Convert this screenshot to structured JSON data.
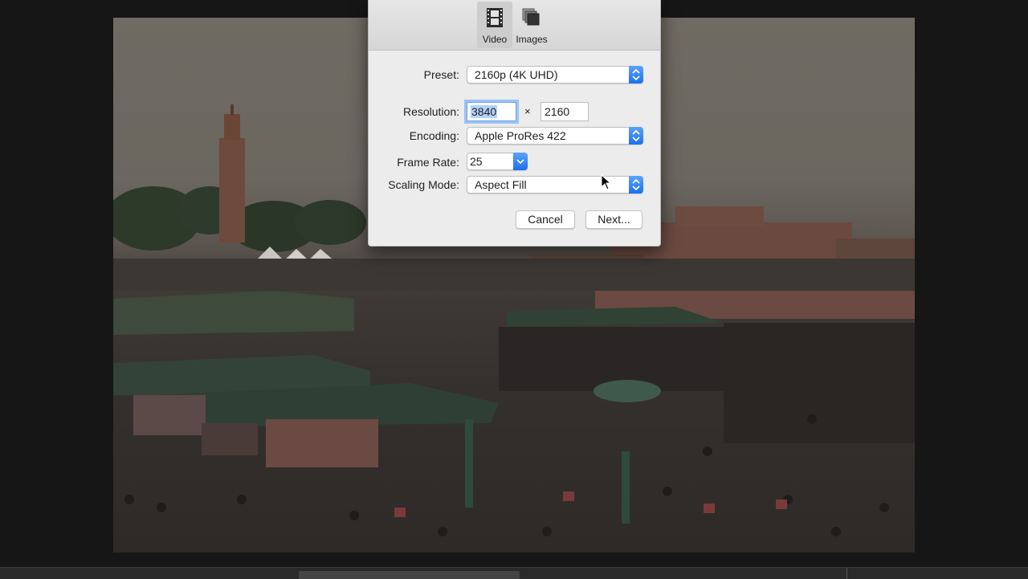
{
  "dialog": {
    "tabs": [
      {
        "label": "Video",
        "icon": "film-icon",
        "selected": true
      },
      {
        "label": "Images",
        "icon": "image-stack-icon",
        "selected": false
      }
    ],
    "preset": {
      "label": "Preset:",
      "value": "2160p (4K UHD)"
    },
    "resolution": {
      "label": "Resolution:",
      "width": "3840",
      "times": "×",
      "height": "2160"
    },
    "encoding": {
      "label": "Encoding:",
      "value": "Apple ProRes 422"
    },
    "frame_rate": {
      "label": "Frame Rate:",
      "value": "25"
    },
    "scaling_mode": {
      "label": "Scaling Mode:",
      "value": "Aspect Fill"
    },
    "buttons": {
      "cancel": "Cancel",
      "next": "Next..."
    }
  },
  "colors": {
    "accent": "#1c6ff0",
    "focus_ring": "#9dc2f6",
    "dialog_bg": "#ececec"
  }
}
